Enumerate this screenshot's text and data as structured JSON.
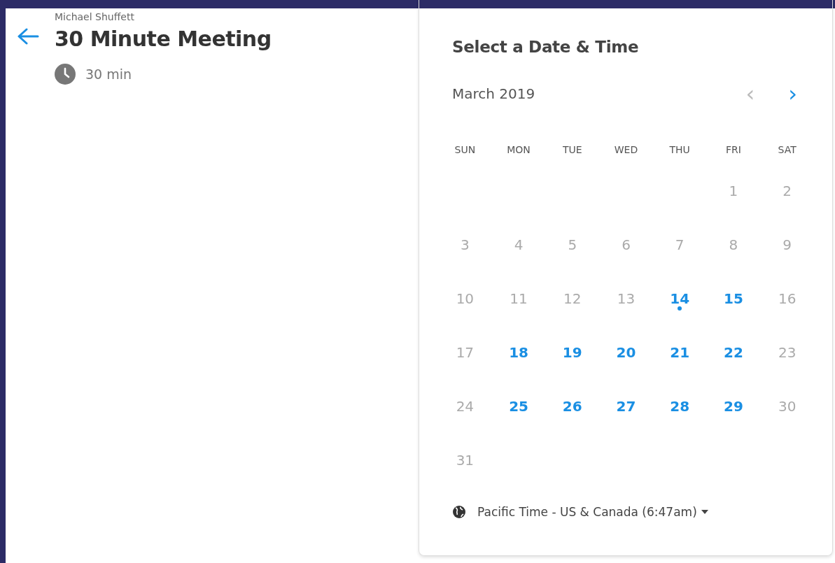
{
  "organizer": "Michael Shuffett",
  "event": {
    "title": "30 Minute Meeting",
    "duration": "30 min"
  },
  "scheduler": {
    "title": "Select a Date & Time",
    "month": "March 2019",
    "prev": {
      "label": "‹",
      "disabled": true
    },
    "next": {
      "label": "›",
      "disabled": false
    },
    "weekdays": [
      "SUN",
      "MON",
      "TUE",
      "WED",
      "THU",
      "FRI",
      "SAT"
    ],
    "weeks": [
      {
        "leading_gap": true,
        "days": [
          {
            "day": "1",
            "available": false,
            "today": false
          },
          {
            "day": "2",
            "available": false,
            "today": false
          }
        ]
      },
      {
        "leading_gap": false,
        "days": [
          {
            "day": "3",
            "available": false,
            "today": false
          },
          {
            "day": "4",
            "available": false,
            "today": false
          },
          {
            "day": "5",
            "available": false,
            "today": false
          },
          {
            "day": "6",
            "available": false,
            "today": false
          },
          {
            "day": "7",
            "available": false,
            "today": false
          },
          {
            "day": "8",
            "available": false,
            "today": false
          },
          {
            "day": "9",
            "available": false,
            "today": false
          }
        ]
      },
      {
        "leading_gap": false,
        "days": [
          {
            "day": "10",
            "available": false,
            "today": false
          },
          {
            "day": "11",
            "available": false,
            "today": false
          },
          {
            "day": "12",
            "available": false,
            "today": false
          },
          {
            "day": "13",
            "available": false,
            "today": false
          },
          {
            "day": "14",
            "available": true,
            "today": true
          },
          {
            "day": "15",
            "available": true,
            "today": false
          },
          {
            "day": "16",
            "available": false,
            "today": false
          }
        ]
      },
      {
        "leading_gap": false,
        "days": [
          {
            "day": "17",
            "available": false,
            "today": false
          },
          {
            "day": "18",
            "available": true,
            "today": false
          },
          {
            "day": "19",
            "available": true,
            "today": false
          },
          {
            "day": "20",
            "available": true,
            "today": false
          },
          {
            "day": "21",
            "available": true,
            "today": false
          },
          {
            "day": "22",
            "available": true,
            "today": false
          },
          {
            "day": "23",
            "available": false,
            "today": false
          }
        ]
      },
      {
        "leading_gap": false,
        "days": [
          {
            "day": "24",
            "available": false,
            "today": false
          },
          {
            "day": "25",
            "available": true,
            "today": false
          },
          {
            "day": "26",
            "available": true,
            "today": false
          },
          {
            "day": "27",
            "available": true,
            "today": false
          },
          {
            "day": "28",
            "available": true,
            "today": false
          },
          {
            "day": "29",
            "available": true,
            "today": false
          },
          {
            "day": "30",
            "available": false,
            "today": false
          }
        ]
      },
      {
        "leading_gap": false,
        "days": [
          {
            "day": "31",
            "available": false,
            "today": false
          }
        ]
      }
    ],
    "timezone": "Pacific Time - US & Canada (6:47am)"
  }
}
